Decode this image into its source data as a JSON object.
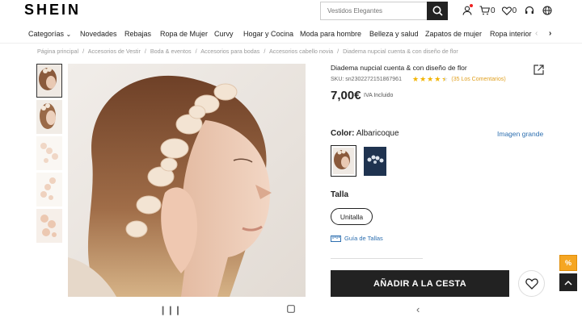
{
  "header": {
    "logo": "SHEIN",
    "search_placeholder": "Vestidos Elegantes",
    "cart_count": "0",
    "wishlist_count": "0"
  },
  "nav": {
    "items": [
      "Categorías",
      "Novedades",
      "Rebajas",
      "Ropa de Mujer",
      "Curvy",
      "Hogar y Cocina",
      "Moda para hombre",
      "Belleza y salud",
      "Zapatos de mujer",
      "Ropa interior"
    ]
  },
  "breadcrumb": [
    "Página principal",
    "/",
    "Accesorios de Vestir",
    "/",
    "Boda & eventos",
    "/",
    "Accesorios para bodas",
    "/",
    "Accesorios cabello novia",
    "/",
    "Diadema nupcial cuenta & con diseño de flor"
  ],
  "product": {
    "title": "Diadema nupcial cuenta & con diseño de flor",
    "sku": "SKU: sn2302272151867961",
    "rating": 4.5,
    "reviews": "(35 Los Comentarios)",
    "price": "7,00€",
    "tax_note": "IVA Incluido",
    "color_label": "Color:",
    "color_value": "Albaricoque",
    "image_large": "Imagen grande",
    "size_label": "Talla",
    "size_option": "Unitalla",
    "size_guide": "Guía de Tallas",
    "add_to_cart": "AÑADIR A LA CESTA"
  },
  "badge_text": "%",
  "colors": {
    "accent_blue": "#2d6fb0",
    "star": "#f2b400",
    "button_dark": "#222222",
    "promo_orange": "#f5a623"
  }
}
